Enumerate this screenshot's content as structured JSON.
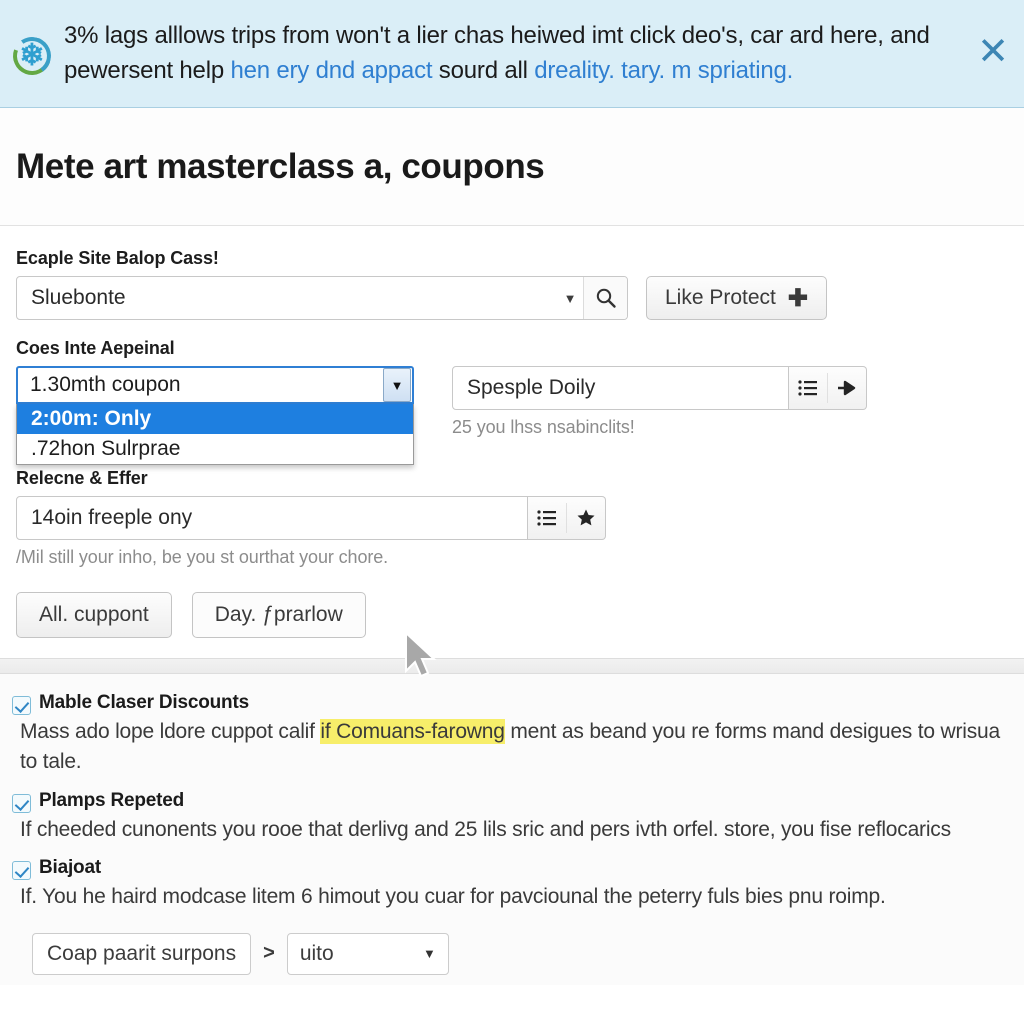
{
  "banner": {
    "icon": "snowflake-badge-icon",
    "line1_before": "3% lags alllows trips from won't a lier chas heiwed imt click deo's, car ard here, and",
    "line2_a": "pewersent help ",
    "line2_link1": "hen ery dnd appact",
    "line2_b": " sourd all ",
    "line2_link2": "dreality. tary. m spriating.",
    "close_label": "✕",
    "link_color": "#2f7fd1",
    "bg_color": "#daeef7"
  },
  "header": {
    "title": "Mete art masterclass a, coupons"
  },
  "form": {
    "search_label": "Ecaple Site Balop Cass!",
    "search_value": "Sluebonte",
    "search_caret": "▼",
    "like_protect_label": "Like Protect",
    "like_protect_plus": "✚",
    "select_label": "Coes Inte Aepeinal",
    "select_value": "1.30mth coupon",
    "select_caret": "▼",
    "select_options": [
      "2:00m: Only",
      ".72hon Sulrprae"
    ],
    "select_selected_index": 0,
    "daily_value": "Spesple Doily",
    "daily_hint": "25 you lhss nsabinclits!",
    "release_label": "Relecne & Effer",
    "release_value": "14oin freeple ony",
    "release_hint": "/Mil still your inho, be you st ourthat your chore.",
    "buttons": [
      {
        "label": "All. cuppont",
        "style": "solid"
      },
      {
        "label": "Day. ƒprarlow",
        "style": "plain"
      }
    ]
  },
  "info": {
    "sections": [
      {
        "title": "Mable Claser Discounts",
        "checked": true,
        "para_before": "Mass ado lope ldore cuppot calif ",
        "para_highlight": "if Comuans-farowng",
        "para_after": " ment as beand you re forms mand desigues to wrisua to tale.",
        "wrap": true
      },
      {
        "title": "Plamps Repeted",
        "checked": true,
        "para_before": "If cheeded cunonents you rooe that derlivg and 25 lils sric and pers ivth orfel. store, you fise reflocarics",
        "para_highlight": "",
        "para_after": "",
        "wrap": false
      },
      {
        "title": "Biajoat",
        "checked": true,
        "para_before": "If. You he haird modcase litem 6 himout you cuar for pavciounal the peterry fuls bies pnu roimp.",
        "para_highlight": "",
        "para_after": "",
        "wrap": false
      }
    ]
  },
  "footer": {
    "crumb_label": "Coap paarit surpons",
    "separator": ">",
    "select_value": "uito",
    "select_caret": "▼"
  }
}
